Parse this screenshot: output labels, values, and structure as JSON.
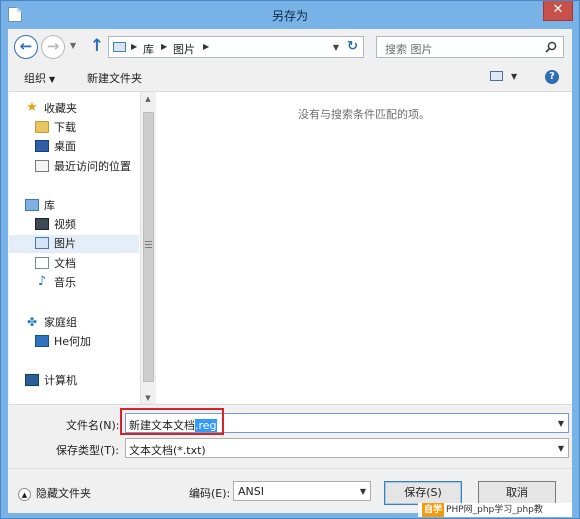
{
  "window": {
    "title": "另存为",
    "close_glyph": "✕"
  },
  "nav": {
    "back_glyph": "←",
    "forward_glyph": "→",
    "dropdown_glyph": "▼",
    "up_glyph": "↑",
    "refresh_glyph": "↻"
  },
  "address": {
    "crumbs": [
      "库",
      "图片"
    ],
    "separator": "▶"
  },
  "search": {
    "placeholder": "搜索 图片"
  },
  "toolbar": {
    "organize_label": "组织",
    "new_folder_label": "新建文件夹",
    "help_glyph": "?"
  },
  "sidebar": {
    "items": [
      {
        "label": "收藏夹",
        "icon": "star-icon"
      },
      {
        "label": "下载",
        "icon": "downloads-folder-icon"
      },
      {
        "label": "桌面",
        "icon": "desktop-icon"
      },
      {
        "label": "最近访问的位置",
        "icon": "recent-places-icon"
      },
      {
        "label": "库",
        "icon": "library-icon"
      },
      {
        "label": "视频",
        "icon": "videos-icon"
      },
      {
        "label": "图片",
        "icon": "pictures-icon",
        "selected": true
      },
      {
        "label": "文档",
        "icon": "documents-icon"
      },
      {
        "label": "音乐",
        "icon": "music-icon"
      },
      {
        "label": "家庭组",
        "icon": "homegroup-icon"
      },
      {
        "label": "He何加",
        "icon": "user-icon"
      },
      {
        "label": "计算机",
        "icon": "computer-icon"
      }
    ]
  },
  "content": {
    "empty_message": "没有与搜索条件匹配的项。"
  },
  "form": {
    "filename_label": "文件名(N):",
    "filename_base": "新建文本文档",
    "filename_ext_selected": ".reg",
    "filetype_label": "保存类型(T):",
    "filetype_value": "文本文档(*.txt)",
    "encoding_label": "编码(E):",
    "encoding_value": "ANSI"
  },
  "footer": {
    "hide_folders_label": "隐藏文件夹",
    "save_label": "保存(S)",
    "cancel_label": "取消",
    "watermark_logo": "自学",
    "watermark_text": "PHP网_php学习_php教"
  },
  "colors": {
    "frame": "#78b2e6",
    "close": "#c7504a",
    "highlight_box": "#d5232a",
    "selection": "#3399ff"
  }
}
